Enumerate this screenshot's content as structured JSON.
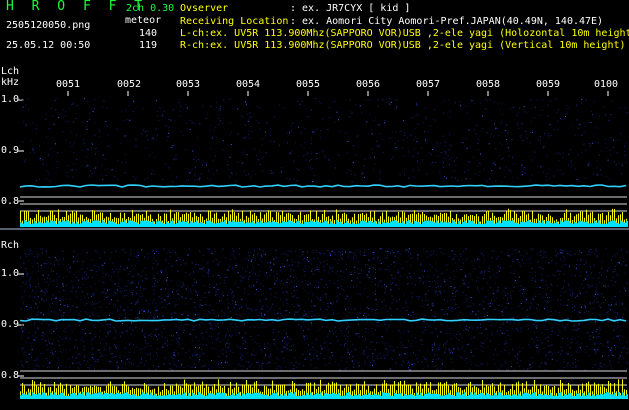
{
  "header": {
    "app_title": "H R O F F T",
    "version": "2ch 0.30",
    "filename": "2505120050.png",
    "datetime": "25.05.12 00:50",
    "meteor_label": "meteor",
    "lch_count": "140",
    "rch_count": "119",
    "observer_key": "Ovserver",
    "observer_val": ": ex. JR7CYX [ kid ]",
    "location_key": "Receiving Location",
    "location_val": ": ex. Aomori City Aomori-Pref.JAPAN(40.49N, 140.47E)",
    "lch_line": "L-ch:ex. UV5R 113.900Mhz(SAPPORO VOR)USB ,2-ele yagi (Holozontal 10m height",
    "rch_line": "R-ch:ex. UV5R 113.900Mhz(SAPPORO VOR)USB ,2-ele yagi (Vertical 10m height)"
  },
  "time_axis": [
    "0051",
    "0052",
    "0053",
    "0054",
    "0055",
    "0056",
    "0057",
    "0058",
    "0059",
    "0100"
  ],
  "lch": {
    "title": "Lch",
    "unit": "kHz",
    "ticks": [
      "1.0",
      "0.9",
      "0.8"
    ]
  },
  "rch": {
    "title": "Rch",
    "ticks": [
      "1.0",
      "0.9",
      "0.8"
    ]
  },
  "colors": {
    "background": "#000000",
    "text_green": "#19ff3a",
    "text_white": "#ffffff",
    "noise_blue": "#1c2c9a",
    "carrier": "#30d0ff",
    "level_yellow": "#ffff00",
    "level_cyan": "#00e0ff"
  }
}
